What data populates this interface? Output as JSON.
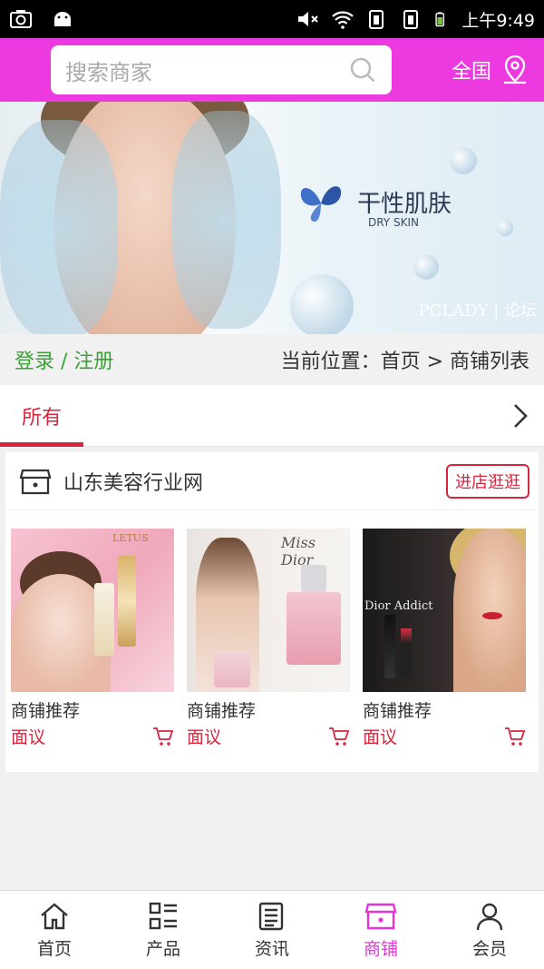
{
  "status_bar": {
    "time": "上午9:49"
  },
  "header": {
    "search_placeholder": "搜索商家",
    "region_label": "全国",
    "accent_color": "#ec3ae0"
  },
  "banner": {
    "title": "干性肌肤",
    "subtitle": "DRY SKIN",
    "watermark": "PCLADY | 论坛"
  },
  "crumbrow": {
    "login_label": "登录 / 注册",
    "breadcrumb": "当前位置：首页 > 商铺列表"
  },
  "tabs": {
    "active": "所有"
  },
  "shop": {
    "name": "山东美容行业网",
    "visit_button": "进店逛逛",
    "products": [
      {
        "name": "商铺推荐",
        "price": "面议",
        "image_text": "LETUS"
      },
      {
        "name": "商铺推荐",
        "price": "面议",
        "image_text": "Miss Dior"
      },
      {
        "name": "商铺推荐",
        "price": "面议",
        "image_text": "Dior Addict"
      }
    ]
  },
  "bottom_nav": {
    "items": [
      {
        "label": "首页",
        "icon": "home-icon"
      },
      {
        "label": "产品",
        "icon": "grid-list-icon"
      },
      {
        "label": "资讯",
        "icon": "news-icon"
      },
      {
        "label": "商铺",
        "icon": "store-icon"
      },
      {
        "label": "会员",
        "icon": "user-icon"
      }
    ],
    "active_index": 3,
    "active_color": "#e533d8"
  }
}
